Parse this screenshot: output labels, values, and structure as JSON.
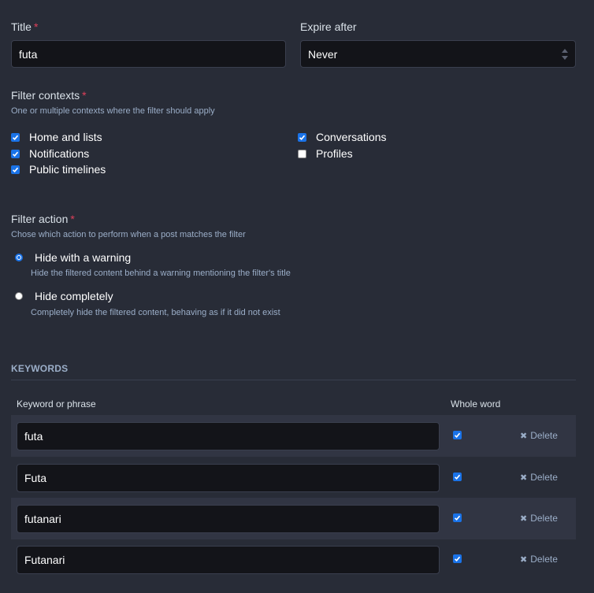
{
  "title_field": {
    "label": "Title",
    "required_mark": "*",
    "value": "futa"
  },
  "expire_field": {
    "label": "Expire after",
    "selected": "Never",
    "icon": "select-arrows-icon"
  },
  "filter_contexts": {
    "label": "Filter contexts",
    "required_mark": "*",
    "hint": "One or multiple contexts where the filter should apply",
    "options": [
      {
        "label": "Home and lists",
        "checked": true
      },
      {
        "label": "Notifications",
        "checked": true
      },
      {
        "label": "Public timelines",
        "checked": true
      },
      {
        "label": "Conversations",
        "checked": true
      },
      {
        "label": "Profiles",
        "checked": false
      }
    ]
  },
  "filter_action": {
    "label": "Filter action",
    "required_mark": "*",
    "hint": "Chose which action to perform when a post matches the filter",
    "options": [
      {
        "label": "Hide with a warning",
        "hint": "Hide the filtered content behind a warning mentioning the filter's title",
        "selected": true
      },
      {
        "label": "Hide completely",
        "hint": "Completely hide the filtered content, behaving as if it did not exist",
        "selected": false
      }
    ]
  },
  "keywords": {
    "heading": "KEYWORDS",
    "col_keyword": "Keyword or phrase",
    "col_whole_word": "Whole word",
    "delete_label": "Delete",
    "delete_icon": "x-icon",
    "rows": [
      {
        "keyword": "futa",
        "whole_word": true
      },
      {
        "keyword": "Futa",
        "whole_word": true
      },
      {
        "keyword": "futanari",
        "whole_word": true
      },
      {
        "keyword": "Futanari",
        "whole_word": true
      }
    ]
  },
  "colors": {
    "background": "#282c37",
    "input_background": "#131419",
    "row_alt": "#313543",
    "required": "#df405a",
    "accent": "#1a73e8",
    "hint": "#9baec8"
  }
}
